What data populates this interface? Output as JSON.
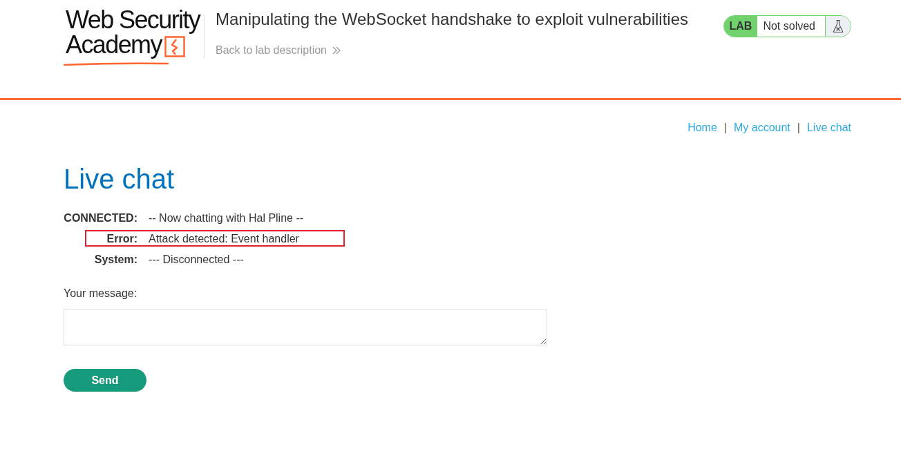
{
  "header": {
    "logo": {
      "line_1": "Web Security",
      "line_2": "Academy"
    },
    "title": "Manipulating the WebSocket handshake to exploit vulnerabilities",
    "back_link": "Back to lab description",
    "lab_status": {
      "tag": "LAB",
      "status": "Not solved",
      "solved": false
    }
  },
  "nav": [
    {
      "kind": "link",
      "label": "Home"
    },
    {
      "kind": "separator",
      "label": "|"
    },
    {
      "kind": "link",
      "label": "My account"
    },
    {
      "kind": "separator",
      "label": "|"
    },
    {
      "kind": "link",
      "label": "Live chat"
    }
  ],
  "page_title": "Live chat",
  "chat": [
    {
      "sender": "CONNECTED:",
      "text": "-- Now chatting with Hal Pline --",
      "highlighted": false
    },
    {
      "sender": "Error:",
      "text": "Attack detected: Event handler",
      "highlighted": true
    },
    {
      "sender": "System:",
      "text": "--- Disconnected ---",
      "highlighted": false
    }
  ],
  "form": {
    "label": "Your message:",
    "send_button": "Send"
  }
}
